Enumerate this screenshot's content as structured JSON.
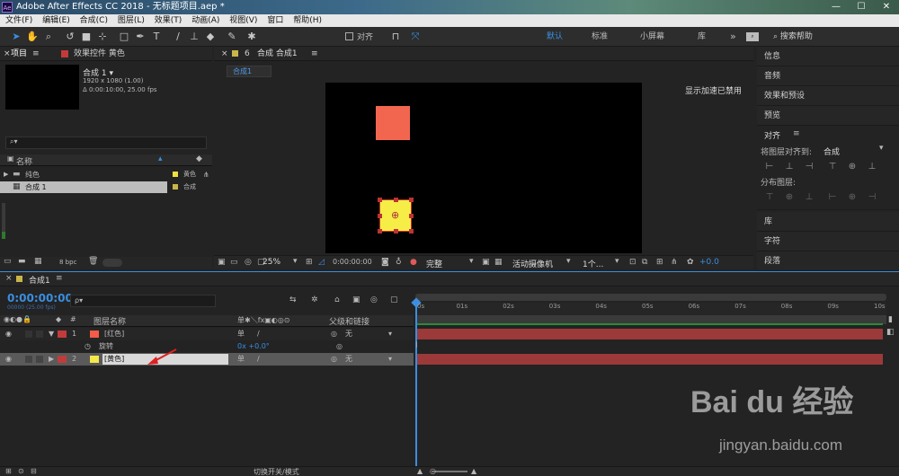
{
  "window": {
    "title": "Adobe After Effects CC 2018 - 无标题项目.aep *",
    "logo": "Ae",
    "min": "—",
    "max": "☐",
    "close": "✕"
  },
  "menu": [
    "文件(F)",
    "编辑(E)",
    "合成(C)",
    "图层(L)",
    "效果(T)",
    "动画(A)",
    "视图(V)",
    "窗口",
    "帮助(H)"
  ],
  "toolbar": {
    "align_label": "对齐",
    "workspaces": [
      "默认",
      "标准",
      "小屏幕",
      "库"
    ],
    "more": "»",
    "search_placeholder": "搜索帮助"
  },
  "project": {
    "tab_project": "项目",
    "tab_effects": "效果控件 黄色",
    "comp_name": "合成 1 ▾",
    "comp_res": "1920 x 1080 (1.00)",
    "comp_dur": "Δ 0:00:10:00, 25.00 fps",
    "col_name": "名称",
    "items": [
      {
        "name": "纯色",
        "type": "黄色",
        "kind": "folder"
      },
      {
        "name": "合成 1",
        "type": "合成",
        "kind": "comp"
      }
    ],
    "bpc": "8 bpc"
  },
  "comp_viewer": {
    "tab_label": "合成 合成1",
    "sub_tab": "合成1",
    "gpu_note": "显示加速已禁用",
    "zoom": "25%",
    "time": "0:00:00:00",
    "quality": "完整",
    "camera": "活动摄像机",
    "views": "1个...",
    "exposure": "+0.0"
  },
  "right_panels": [
    "信息",
    "音频",
    "效果和预设",
    "预览",
    "对齐",
    "库",
    "字符",
    "段落"
  ],
  "align_panel": {
    "align_to_label": "将图层对齐到:",
    "align_to_value": "合成",
    "distribute_label": "分布图层:"
  },
  "timeline": {
    "tab": "合成1",
    "timecode": "0:00:00:00",
    "timecode_sub": "00000 (25.00 fps)",
    "search_placeholder": "ρ▾",
    "col_layer_name": "图层名称",
    "col_parent": "父级和链接",
    "layers": [
      {
        "index": "1",
        "name": "[红色]",
        "parent": "无",
        "color": "#c23b3b",
        "swatch": "#f45b48"
      },
      {
        "index": "",
        "name": "旋转",
        "value": "0x +0.0°",
        "is_prop": true
      },
      {
        "index": "2",
        "name": "[黄色]",
        "parent": "无",
        "color": "#c23b3b",
        "swatch": "#f4e84a",
        "selected": true
      }
    ],
    "ticks": [
      "0s",
      "01s",
      "02s",
      "03s",
      "04s",
      "05s",
      "06s",
      "07s",
      "08s",
      "09s",
      "10s"
    ],
    "bottom_label": "切换开关/模式"
  },
  "watermark": {
    "brand": "Bai du 经验",
    "url": "jingyan.baidu.com"
  },
  "colors": {
    "accent": "#3b8ee0",
    "red_layer": "#f26650",
    "yellow_layer": "#f6ed46",
    "track_red": "#9c3a3a"
  }
}
